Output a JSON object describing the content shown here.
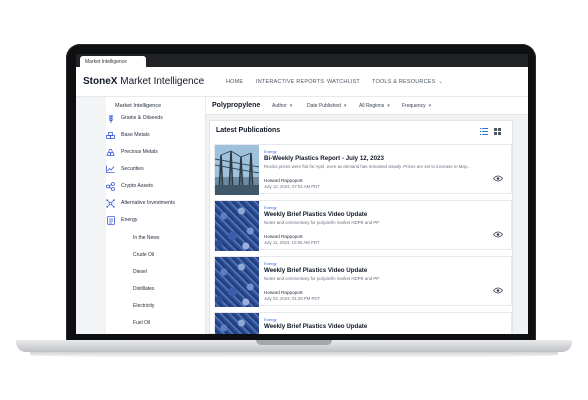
{
  "browser": {
    "tab_label": "Market Intelligence"
  },
  "header": {
    "logo_brand": "StoneX",
    "logo_product": "Market Intelligence",
    "nav": [
      {
        "label": "HOME"
      },
      {
        "label": "INTERACTIVE REPORTS"
      },
      {
        "label": "WATCHLIST"
      },
      {
        "label": "TOOLS & RESOURCES"
      }
    ]
  },
  "sidebar": {
    "title": "Market Intelligence",
    "items": [
      {
        "label": "Grains & Oilseeds",
        "icon": "wheat-icon"
      },
      {
        "label": "Base Metals",
        "icon": "metal-bars-icon"
      },
      {
        "label": "Precious Metals",
        "icon": "gold-bars-icon"
      },
      {
        "label": "Securities",
        "icon": "trend-chart-icon"
      },
      {
        "label": "Crypto Assets",
        "icon": "crypto-icon"
      },
      {
        "label": "Alternative Investments",
        "icon": "network-icon"
      },
      {
        "label": "Energy",
        "icon": "energy-icon"
      }
    ],
    "subitems": [
      {
        "label": "In the News"
      },
      {
        "label": "Crude Oil"
      },
      {
        "label": "Diesel"
      },
      {
        "label": "Distillates"
      },
      {
        "label": "Electricity"
      },
      {
        "label": "Fuel Oil"
      }
    ]
  },
  "filters": {
    "page_title": "Polypropylene",
    "items": [
      {
        "label": "Author"
      },
      {
        "label": "Date Published"
      },
      {
        "label": "All Regions"
      },
      {
        "label": "Frequency"
      }
    ]
  },
  "main": {
    "panel_title": "Latest Publications",
    "publications": [
      {
        "category": "Energy",
        "title": "Bi-Weekly Plastics Report - July 12, 2023",
        "description": "Resins prices were flat for April, even as demand has remained steady. Prices are set to increase in May...",
        "author": "Howard Rappoport",
        "date": "July 12, 2023, 07:04 AM PDT"
      },
      {
        "category": "Energy",
        "title": "Weekly Brief Plastics Video Update",
        "description": "Notes and commentary for polyolefin market HDPE and PP",
        "author": "Howard Rappoport",
        "date": "July 11, 2023, 10:06 AM PDT"
      },
      {
        "category": "Energy",
        "title": "Weekly Brief Plastics Video Update",
        "description": "Notes and commentary for polyolefin market HDPE and PP",
        "author": "Howard Rappoport",
        "date": "July 03, 2023, 01:29 PM PDT"
      },
      {
        "category": "Energy",
        "title": "Weekly Brief Plastics Video Update",
        "description": "",
        "author": "",
        "date": ""
      }
    ]
  },
  "colors": {
    "accent": "#2f6fd6",
    "icon": "#3b5bdb",
    "frame": "#0e0f11"
  }
}
